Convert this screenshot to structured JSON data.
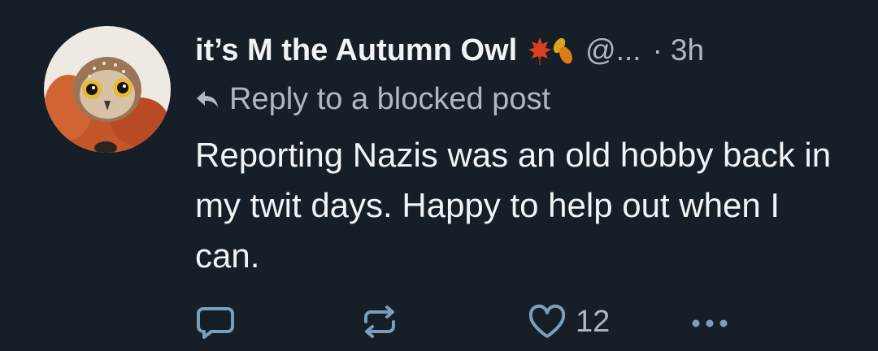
{
  "post": {
    "display_name": "it’s M the Autumn Owl",
    "emoji": [
      "🍁",
      "🍂"
    ],
    "handle": "@...",
    "separator": "·",
    "time": "3h",
    "reply_label": "Reply to a blocked post",
    "text": "Reporting Nazis was an old hobby back in my twit days. Happy to help out when I can.",
    "like_count": "12"
  },
  "icons": {
    "reply_indicator": "reply-arrow-icon",
    "comment": "comment-bubble-icon",
    "repost": "repost-arrows-icon",
    "like": "heart-outline-icon",
    "more": "ellipsis-icon"
  },
  "colors": {
    "background": "#161e27",
    "primary_text": "#f1f3f5",
    "secondary_text": "#aeb8c4",
    "icon": "#7c9ebd"
  }
}
